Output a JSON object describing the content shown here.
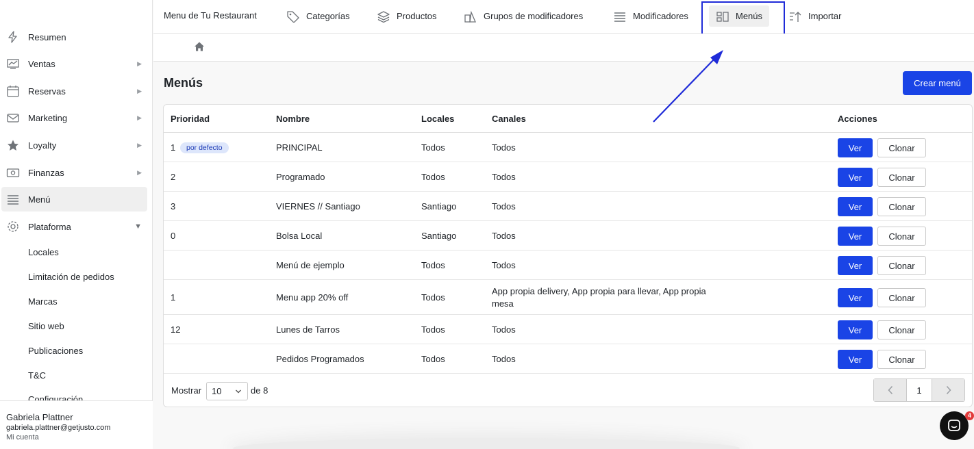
{
  "sidebar": {
    "items": [
      {
        "label": "Resumen",
        "icon": "bolt-icon",
        "has_arrow": false
      },
      {
        "label": "Ventas",
        "icon": "chart-icon",
        "has_arrow": true
      },
      {
        "label": "Reservas",
        "icon": "calendar-icon",
        "has_arrow": true
      },
      {
        "label": "Marketing",
        "icon": "mail-icon",
        "has_arrow": true
      },
      {
        "label": "Loyalty",
        "icon": "star-icon",
        "has_arrow": true
      },
      {
        "label": "Finanzas",
        "icon": "money-icon",
        "has_arrow": true
      },
      {
        "label": "Menú",
        "icon": "list-icon",
        "has_arrow": false,
        "active": true
      },
      {
        "label": "Plataforma",
        "icon": "gear-icon",
        "has_arrow": true,
        "expanded": true
      }
    ],
    "arrow_right": "▶",
    "arrow_down": "▼",
    "subitems": [
      "Locales",
      "Limitación de pedidos",
      "Marcas",
      "Sitio web",
      "Publicaciones",
      "T&C",
      "Configuración"
    ]
  },
  "user": {
    "name": "Gabriela Plattner",
    "email": "gabriela.plattner@getjusto.com",
    "link": "Mi cuenta"
  },
  "topbar": {
    "brand": "Menu de Tu Restaurant",
    "tabs": [
      {
        "label": "Categorías",
        "icon": "tag-icon"
      },
      {
        "label": "Productos",
        "icon": "layers-icon"
      },
      {
        "label": "Grupos de modificadores",
        "icon": "shapes-icon"
      },
      {
        "label": "Modificadores",
        "icon": "list-icon"
      },
      {
        "label": "Menús",
        "icon": "menus-icon",
        "active": true
      },
      {
        "label": "Importar",
        "icon": "import-icon"
      }
    ]
  },
  "main": {
    "title": "Menús",
    "create_button": "Crear menú",
    "columns": [
      "Prioridad",
      "Nombre",
      "Locales",
      "Canales",
      "Acciones"
    ],
    "default_badge": "por defecto",
    "view_label": "Ver",
    "clone_label": "Clonar",
    "rows": [
      {
        "priority": "1",
        "name": "PRINCIPAL",
        "locales": "Todos",
        "canales": "Todos",
        "default": true
      },
      {
        "priority": "2",
        "name": "Programado",
        "locales": "Todos",
        "canales": "Todos"
      },
      {
        "priority": "3",
        "name": "VIERNES // Santiago",
        "locales": "Santiago",
        "canales": "Todos"
      },
      {
        "priority": "0",
        "name": "Bolsa Local",
        "locales": "Santiago",
        "canales": "Todos"
      },
      {
        "priority": "",
        "name": "Menú de ejemplo",
        "locales": "Todos",
        "canales": "Todos"
      },
      {
        "priority": "1",
        "name": "Menu app 20% off",
        "locales": "Todos",
        "canales": "App propia delivery, App propia para llevar, App propia mesa"
      },
      {
        "priority": "12",
        "name": "Lunes de Tarros",
        "locales": "Todos",
        "canales": "Todos"
      },
      {
        "priority": "",
        "name": "Pedidos Programados",
        "locales": "Todos",
        "canales": "Todos"
      }
    ],
    "pagination": {
      "show_label": "Mostrar",
      "page_size": "10",
      "of_label": "de 8",
      "current_page": "1"
    }
  },
  "chat": {
    "badge": "4"
  },
  "colors": {
    "primary": "#1a44e6",
    "annotation": "#1f2bd8",
    "badge_bg": "#dde6fb"
  }
}
